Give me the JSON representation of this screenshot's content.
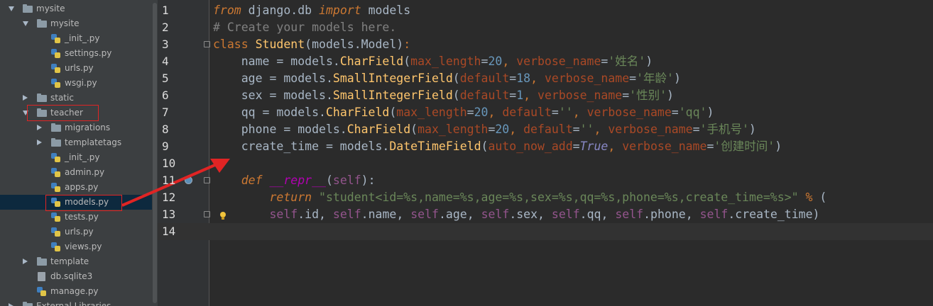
{
  "tree": {
    "items": [
      {
        "label": "mysite",
        "type": "folder",
        "state": "open",
        "depth": 0
      },
      {
        "label": "mysite",
        "type": "folder",
        "state": "open",
        "depth": 1
      },
      {
        "label": "_init_.py",
        "type": "py",
        "depth": 2
      },
      {
        "label": "settings.py",
        "type": "py",
        "depth": 2
      },
      {
        "label": "urls.py",
        "type": "py",
        "depth": 2
      },
      {
        "label": "wsgi.py",
        "type": "py",
        "depth": 2
      },
      {
        "label": "static",
        "type": "folder",
        "state": "closed",
        "depth": 1
      },
      {
        "label": "teacher",
        "type": "folder",
        "state": "open",
        "depth": 1
      },
      {
        "label": "migrations",
        "type": "folder",
        "state": "closed",
        "depth": 2
      },
      {
        "label": "templatetags",
        "type": "folder",
        "state": "closed",
        "depth": 2
      },
      {
        "label": "_init_.py",
        "type": "py",
        "depth": 2
      },
      {
        "label": "admin.py",
        "type": "py",
        "depth": 2
      },
      {
        "label": "apps.py",
        "type": "py",
        "depth": 2
      },
      {
        "label": "models.py",
        "type": "py",
        "depth": 2,
        "selected": true
      },
      {
        "label": "tests.py",
        "type": "py",
        "depth": 2
      },
      {
        "label": "urls.py",
        "type": "py",
        "depth": 2
      },
      {
        "label": "views.py",
        "type": "py",
        "depth": 2
      },
      {
        "label": "template",
        "type": "folder",
        "state": "closed",
        "depth": 1
      },
      {
        "label": "db.sqlite3",
        "type": "file",
        "depth": 1
      },
      {
        "label": "manage.py",
        "type": "py",
        "depth": 1
      },
      {
        "label": "External Libraries",
        "type": "folder",
        "state": "closed",
        "depth": 0
      }
    ]
  },
  "editor": {
    "line_numbers": [
      "1",
      "2",
      "3",
      "4",
      "5",
      "6",
      "7",
      "8",
      "9",
      "10",
      "11",
      "12",
      "13",
      "14"
    ],
    "lines": [
      [
        [
          "kwi",
          "from"
        ],
        [
          "",
          " django.db "
        ],
        [
          "kwi",
          "import"
        ],
        [
          "",
          " models"
        ]
      ],
      [
        [
          "cm",
          "# Create your models here."
        ]
      ],
      [
        [
          "kw",
          "class "
        ],
        [
          "cls",
          "Student"
        ],
        [
          "",
          "(models.Model)"
        ],
        [
          "kw",
          ":"
        ]
      ],
      [
        [
          "",
          "    name = models."
        ],
        [
          "cf",
          "CharField"
        ],
        [
          "",
          "("
        ],
        [
          "kwa",
          "max_length"
        ],
        [
          "",
          "="
        ],
        [
          "num",
          "20"
        ],
        [
          "kw",
          ", "
        ],
        [
          "kwa",
          "verbose_name"
        ],
        [
          "",
          "="
        ],
        [
          "str",
          "'姓名'"
        ],
        [
          "",
          ")"
        ]
      ],
      [
        [
          "",
          "    age = models."
        ],
        [
          "cf",
          "SmallIntegerField"
        ],
        [
          "",
          "("
        ],
        [
          "kwa",
          "default"
        ],
        [
          "",
          "="
        ],
        [
          "num",
          "18"
        ],
        [
          "kw",
          ", "
        ],
        [
          "kwa",
          "verbose_name"
        ],
        [
          "",
          "="
        ],
        [
          "str",
          "'年龄'"
        ],
        [
          "",
          ")"
        ]
      ],
      [
        [
          "",
          "    sex = models."
        ],
        [
          "cf",
          "SmallIntegerField"
        ],
        [
          "",
          "("
        ],
        [
          "kwa",
          "default"
        ],
        [
          "",
          "="
        ],
        [
          "num",
          "1"
        ],
        [
          "kw",
          ", "
        ],
        [
          "kwa",
          "verbose_name"
        ],
        [
          "",
          "="
        ],
        [
          "str",
          "'性别'"
        ],
        [
          "",
          ")"
        ]
      ],
      [
        [
          "",
          "    qq = models."
        ],
        [
          "cf",
          "CharField"
        ],
        [
          "",
          "("
        ],
        [
          "kwa",
          "max_length"
        ],
        [
          "",
          "="
        ],
        [
          "num",
          "20"
        ],
        [
          "kw",
          ", "
        ],
        [
          "kwa",
          "default"
        ],
        [
          "",
          "="
        ],
        [
          "str",
          "''"
        ],
        [
          "kw",
          ", "
        ],
        [
          "kwa",
          "verbose_name"
        ],
        [
          "",
          "="
        ],
        [
          "str",
          "'qq'"
        ],
        [
          "",
          ")"
        ]
      ],
      [
        [
          "",
          "    phone = models."
        ],
        [
          "cf",
          "CharField"
        ],
        [
          "",
          "("
        ],
        [
          "kwa",
          "max_length"
        ],
        [
          "",
          "="
        ],
        [
          "num",
          "20"
        ],
        [
          "kw",
          ", "
        ],
        [
          "kwa",
          "default"
        ],
        [
          "",
          "="
        ],
        [
          "str",
          "''"
        ],
        [
          "kw",
          ", "
        ],
        [
          "kwa",
          "verbose_name"
        ],
        [
          "",
          "="
        ],
        [
          "str",
          "'手机号'"
        ],
        [
          "",
          ")"
        ]
      ],
      [
        [
          "",
          "    create_time = models."
        ],
        [
          "cf",
          "DateTimeField"
        ],
        [
          "",
          "("
        ],
        [
          "kwa",
          "auto_now_add"
        ],
        [
          "",
          "="
        ],
        [
          "tru",
          "True"
        ],
        [
          "kw",
          ", "
        ],
        [
          "kwa",
          "verbose_name"
        ],
        [
          "",
          "="
        ],
        [
          "str",
          "'创建时间'"
        ],
        [
          "",
          ")"
        ]
      ],
      [],
      [
        [
          "",
          "    "
        ],
        [
          "kwi",
          "def "
        ],
        [
          "mth",
          "__repr__"
        ],
        [
          "",
          "("
        ],
        [
          "slf",
          "self"
        ],
        [
          "",
          "):"
        ]
      ],
      [
        [
          "",
          "        "
        ],
        [
          "kwi",
          "return "
        ],
        [
          "str",
          "\"student<id=%s,name=%s,age=%s,sex=%s,qq=%s,phone=%s,create_time=%s>\""
        ],
        [
          "",
          " "
        ],
        [
          "kw",
          "%"
        ],
        [
          "",
          " ("
        ]
      ],
      [
        [
          "",
          "        "
        ],
        [
          "slf",
          "self"
        ],
        [
          "",
          ".id, "
        ],
        [
          "slf",
          "self"
        ],
        [
          "",
          ".name, "
        ],
        [
          "slf",
          "self"
        ],
        [
          "",
          ".age, "
        ],
        [
          "slf",
          "self"
        ],
        [
          "",
          ".sex, "
        ],
        [
          "slf",
          "self"
        ],
        [
          "",
          ".qq, "
        ],
        [
          "slf",
          "self"
        ],
        [
          "",
          ".phone, "
        ],
        [
          "slf",
          "self"
        ],
        [
          "",
          ".create_time)"
        ]
      ],
      []
    ]
  },
  "colors": {
    "tree_bg": "#3c3f41",
    "editor_bg": "#2b2b2b",
    "gutter_bg": "#313335",
    "highlight_red": "#e02424",
    "selection": "#0d293e"
  }
}
